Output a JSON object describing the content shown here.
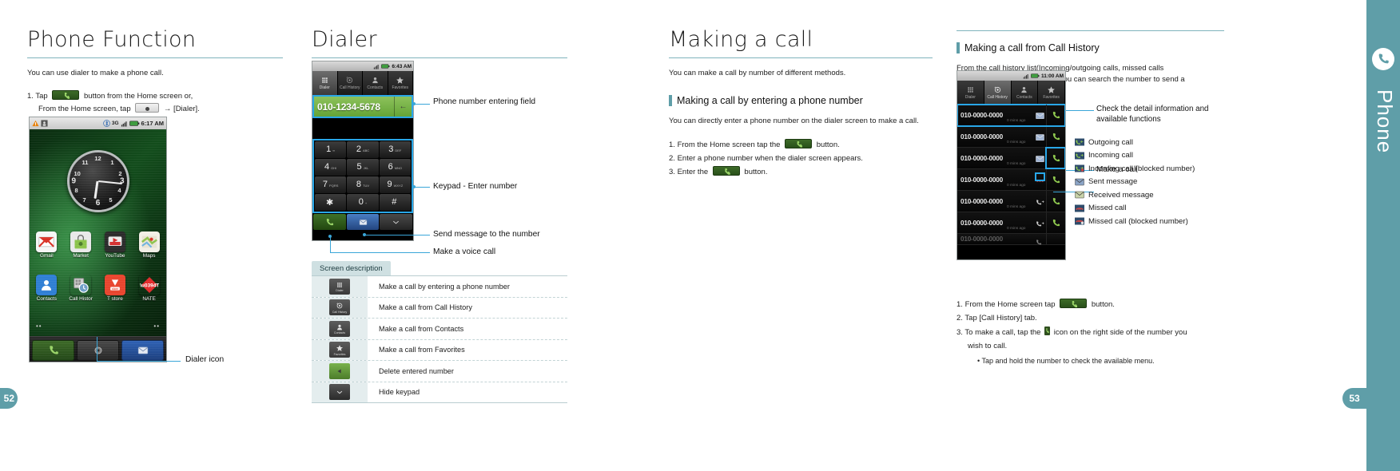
{
  "spine": {
    "label": "Phone",
    "icon": "phone-handset-icon"
  },
  "pages": {
    "left": "52",
    "right": "53"
  },
  "col1": {
    "title": "Phone Function",
    "lead": "You can use dialer to make a phone call.",
    "step1_a": "1.  Tap",
    "step1_b": "button from the Home screen or,",
    "step1_c": "From the Home screen, tap",
    "step1_d": "→ [Dialer].",
    "callout_dialer_icon": "Dialer icon",
    "phone": {
      "status_time": "6:17 AM",
      "status_network": "3G",
      "apps_row1": [
        {
          "label": "Gmail",
          "icon": "gmail-icon"
        },
        {
          "label": "Market",
          "icon": "market-icon"
        },
        {
          "label": "YouTube",
          "icon": "youtube-icon"
        },
        {
          "label": "Maps",
          "icon": "maps-icon"
        }
      ],
      "apps_row2": [
        {
          "label": "Contacts",
          "icon": "contacts-icon"
        },
        {
          "label": "Call Histor",
          "icon": "call-history-icon"
        },
        {
          "label": "T store",
          "icon": "tstore-icon"
        },
        {
          "label": "NATE",
          "icon": "nate-icon"
        }
      ],
      "clock_numbers": [
        "12",
        "1",
        "2",
        "3",
        "4",
        "5",
        "6",
        "7",
        "8",
        "9",
        "10",
        "11"
      ],
      "dock": [
        {
          "name": "dock-dialer-button",
          "icon": "phone-handset-icon"
        },
        {
          "name": "dock-apps-button",
          "icon": "apps-grid-icon"
        },
        {
          "name": "dock-message-button",
          "icon": "envelope-icon"
        }
      ]
    }
  },
  "col2": {
    "title": "Dialer",
    "phone": {
      "status_time": "6:43 AM",
      "tabs": [
        {
          "label": "Dialer",
          "icon": "keypad-grid-icon",
          "active": true
        },
        {
          "label": "Call History",
          "icon": "call-history-icon",
          "active": false
        },
        {
          "label": "Contacts",
          "icon": "person-icon",
          "active": false
        },
        {
          "label": "Favorites",
          "icon": "star-icon",
          "active": false
        }
      ],
      "number": "010-1234-5678",
      "delete_glyph": "←",
      "keys": [
        {
          "d": "1",
          "s": "∞"
        },
        {
          "d": "2",
          "s": "ABC"
        },
        {
          "d": "3",
          "s": "DEF"
        },
        {
          "d": "4",
          "s": "GHI"
        },
        {
          "d": "5",
          "s": "JKL"
        },
        {
          "d": "6",
          "s": "MNO"
        },
        {
          "d": "7",
          "s": "PQRS"
        },
        {
          "d": "8",
          "s": "TUV"
        },
        {
          "d": "9",
          "s": "WXYZ"
        },
        {
          "d": "✱",
          "s": ""
        },
        {
          "d": "0",
          "s": "+"
        },
        {
          "d": "#",
          "s": ""
        }
      ],
      "actions": [
        {
          "name": "voice-call-button",
          "icon": "phone-handset-icon"
        },
        {
          "name": "send-message-button",
          "icon": "envelope-icon"
        },
        {
          "name": "hide-keypad-button",
          "icon": "chevron-down-icon"
        }
      ]
    },
    "callouts": {
      "number_field": "Phone number entering field",
      "keypad": "Keypad - Enter number",
      "send_message": "Send message to the number",
      "voice_call": "Make a voice call"
    },
    "screen_description": {
      "header": "Screen description",
      "rows": [
        {
          "icon": "keypad-grid-icon",
          "chip_label": "Dialer",
          "text": "Make a call by entering a phone number"
        },
        {
          "icon": "call-history-icon",
          "chip_label": "Call History",
          "text": "Make a call from Call History"
        },
        {
          "icon": "person-icon",
          "chip_label": "Contacts",
          "text": "Make a call from Contacts"
        },
        {
          "icon": "star-icon",
          "chip_label": "Favorites",
          "text": "Make a call from Favorites"
        },
        {
          "icon": "backspace-icon",
          "chip_label": "",
          "text": "Delete entered number"
        },
        {
          "icon": "chevron-down-icon",
          "chip_label": "",
          "text": "Hide keypad"
        }
      ]
    }
  },
  "col3": {
    "title": "Making a call",
    "lead": "You can make a call by number of different methods.",
    "h2": "Making a call by entering a phone number",
    "body": "You can directly enter a phone number on the dialer screen to make a call.",
    "steps": [
      {
        "num": "1.",
        "a": "From the Home screen tap the",
        "b": "button.",
        "has_icon": true
      },
      {
        "num": "2.",
        "a": "Enter a phone number when the dialer screen appears.",
        "b": "",
        "has_icon": false
      },
      {
        "num": "3.",
        "a": "Enter the",
        "b": "button.",
        "has_icon": true
      }
    ]
  },
  "col4": {
    "h2": "Making a call from Call History",
    "body": "From the call history list(Incoming/outgoing calls, missed calls incoming/outgoing messages) you can search the number to send a message or make a call.",
    "phone": {
      "status_time": "11:00 AM",
      "tabs": [
        {
          "label": "Dialer",
          "icon": "keypad-grid-icon",
          "active": false
        },
        {
          "label": "Call History",
          "icon": "call-history-icon",
          "active": true
        },
        {
          "label": "Contacts",
          "icon": "person-icon",
          "active": false
        },
        {
          "label": "Favorites",
          "icon": "star-icon",
          "active": false
        }
      ],
      "rows": [
        {
          "number": "010-0000-0000",
          "ago": "0 mins ago",
          "type": "sent-message-icon",
          "highlight": true
        },
        {
          "number": "010-0000-0000",
          "ago": "0 mins ago",
          "type": "sent-message-icon",
          "highlight": false
        },
        {
          "number": "010-0000-0000",
          "ago": "0 mins ago",
          "type": "sent-message-icon",
          "highlight": false
        },
        {
          "number": "010-0000-0000",
          "ago": "0 mins ago",
          "type": "missed-call-icon",
          "highlight": false
        },
        {
          "number": "010-0000-0000",
          "ago": "0 mins ago",
          "type": "outgoing-call-icon",
          "highlight": false
        },
        {
          "number": "010-0000-0000",
          "ago": "0 mins ago",
          "type": "outgoing-call-icon",
          "highlight": false
        },
        {
          "number": "010-0000-0000",
          "ago": "0 mins ago",
          "type": "outgoing-call-icon",
          "highlight": false
        }
      ]
    },
    "callouts": {
      "detail": "Check the detail information and available functions",
      "make_call": "Make a call"
    },
    "legend": [
      {
        "icon": "outgoing-call-icon",
        "label": "Outgoing call"
      },
      {
        "icon": "incoming-call-icon",
        "label": "Incoming call"
      },
      {
        "icon": "incoming-call-blocked-icon",
        "label": "Incoming call (blocked number)"
      },
      {
        "icon": "sent-message-icon",
        "label": "Sent message"
      },
      {
        "icon": "received-message-icon",
        "label": "Received message"
      },
      {
        "icon": "missed-call-icon",
        "label": "Missed call"
      },
      {
        "icon": "missed-call-blocked-icon",
        "label": "Missed call (blocked number)"
      }
    ],
    "steps": [
      {
        "num": "1.",
        "a": "From the Home screen tap",
        "b": "button.",
        "has_icon": true
      },
      {
        "num": "2.",
        "a": "Tap [Call History] tab.",
        "b": "",
        "has_icon": false
      }
    ],
    "step3_a": "3.  To make a call, tap the",
    "step3_b": "icon on the right side of the number you",
    "step3_c": "wish to call.",
    "note": "• Tap and hold the number to check the available menu."
  },
  "colors": {
    "accent": "#5f9ea8",
    "callout": "#3aa6d8",
    "table_head": "#cfe0e2"
  }
}
